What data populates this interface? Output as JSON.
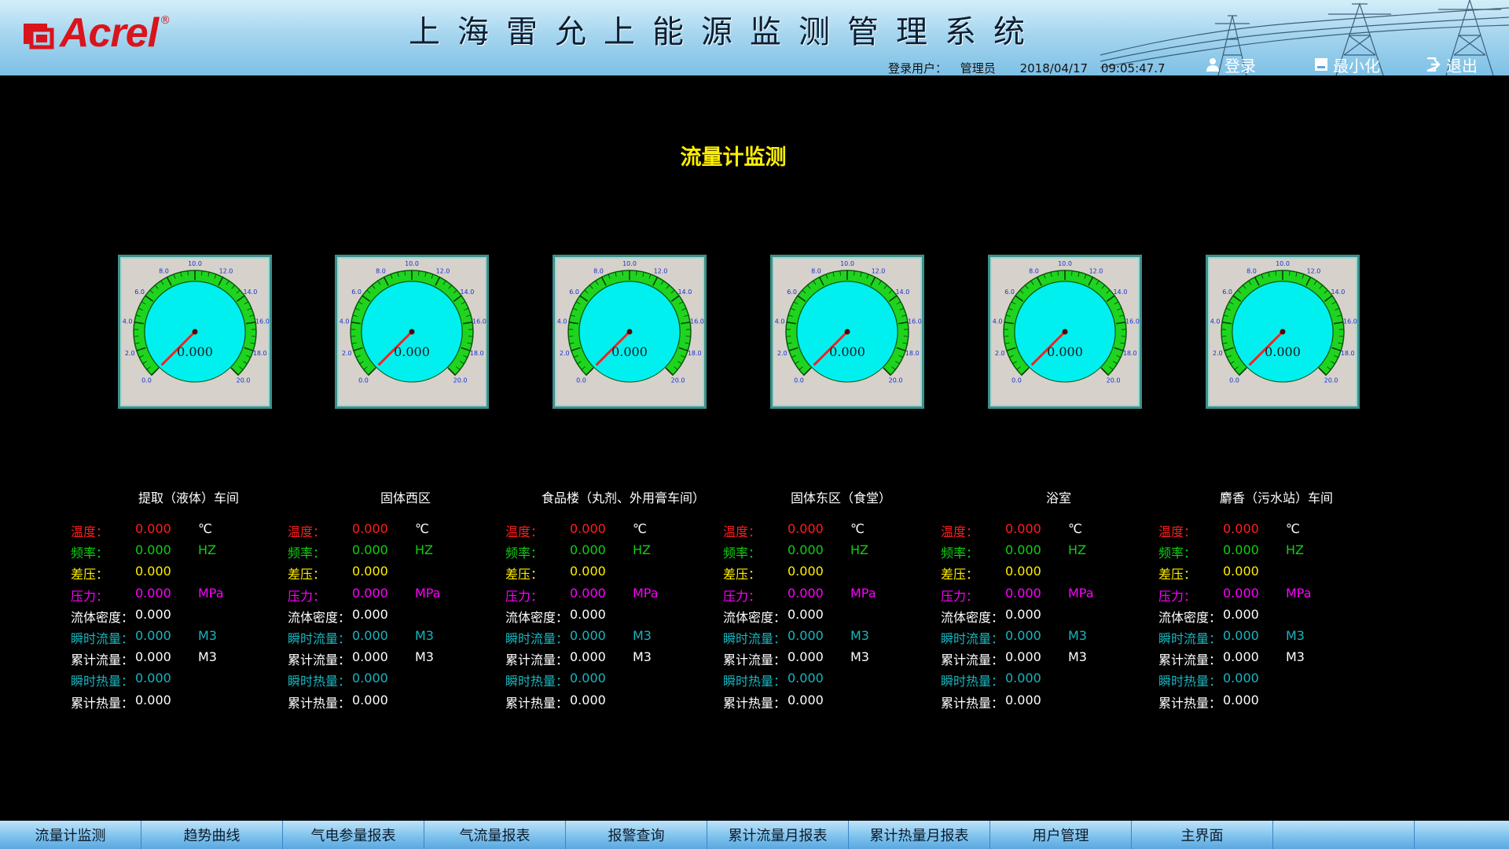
{
  "header": {
    "logo_text": "Acrel",
    "logo_reg": "®",
    "system_title": "上海雷允上能源监测管理系统",
    "login_label": "登录用户：",
    "user": "管理员",
    "date": "2018/04/17",
    "time": "09:05:47.7",
    "buttons": {
      "login": "登录",
      "minimize": "最小化",
      "logout": "退出"
    }
  },
  "page_title": "流量计监测",
  "gauge": {
    "ticks": [
      "0.0",
      "2.0",
      "4.0",
      "6.0",
      "8.0",
      "10.0",
      "12.0",
      "14.0",
      "16.0",
      "18.0",
      "20.0"
    ],
    "min": 0,
    "max": 20
  },
  "colors": {
    "temp": "#ff1e1e",
    "freq": "#10d010",
    "diff": "#ffee00",
    "pressure": "#ff00ff",
    "flow": "#17b6c0",
    "white": "#ffffff"
  },
  "labels": {
    "temp": "温度：",
    "freq": "频率：",
    "diff": "差压：",
    "pressure": "压力：",
    "density": "流体密度：",
    "inst_flow": "瞬时流量：",
    "total_flow": "累计流量：",
    "inst_heat": "瞬时热量：",
    "total_heat": "累计热量："
  },
  "units": {
    "temp": "℃",
    "freq": "HZ",
    "pressure": "MPa",
    "inst_flow": "M3",
    "total_flow": "M3"
  },
  "meters": [
    {
      "name": "提取（液体）车间",
      "gauge_value": "0.000",
      "temp": "0.000",
      "freq": "0.000",
      "diff": "0.000",
      "pressure": "0.000",
      "density": "0.000",
      "inst_flow": "0.000",
      "total_flow": "0.000",
      "inst_heat": "0.000",
      "total_heat": "0.000"
    },
    {
      "name": "固体西区",
      "gauge_value": "0.000",
      "temp": "0.000",
      "freq": "0.000",
      "diff": "0.000",
      "pressure": "0.000",
      "density": "0.000",
      "inst_flow": "0.000",
      "total_flow": "0.000",
      "inst_heat": "0.000",
      "total_heat": "0.000"
    },
    {
      "name": "食品楼（丸剂、外用膏车间）",
      "gauge_value": "0.000",
      "temp": "0.000",
      "freq": "0.000",
      "diff": "0.000",
      "pressure": "0.000",
      "density": "0.000",
      "inst_flow": "0.000",
      "total_flow": "0.000",
      "inst_heat": "0.000",
      "total_heat": "0.000"
    },
    {
      "name": "固体东区（食堂）",
      "gauge_value": "0.000",
      "temp": "0.000",
      "freq": "0.000",
      "diff": "0.000",
      "pressure": "0.000",
      "density": "0.000",
      "inst_flow": "0.000",
      "total_flow": "0.000",
      "inst_heat": "0.000",
      "total_heat": "0.000"
    },
    {
      "name": "浴室",
      "gauge_value": "0.000",
      "temp": "0.000",
      "freq": "0.000",
      "diff": "0.000",
      "pressure": "0.000",
      "density": "0.000",
      "inst_flow": "0.000",
      "total_flow": "0.000",
      "inst_heat": "0.000",
      "total_heat": "0.000"
    },
    {
      "name": "麝香（污水站）车间",
      "gauge_value": "0.000",
      "temp": "0.000",
      "freq": "0.000",
      "diff": "0.000",
      "pressure": "0.000",
      "density": "0.000",
      "inst_flow": "0.000",
      "total_flow": "0.000",
      "inst_heat": "0.000",
      "total_heat": "0.000"
    }
  ],
  "nav": [
    "流量计监测",
    "趋势曲线",
    "气电参量报表",
    "气流量报表",
    "报警查询",
    "累计流量月报表",
    "累计热量月报表",
    "用户管理",
    "主界面",
    ""
  ]
}
